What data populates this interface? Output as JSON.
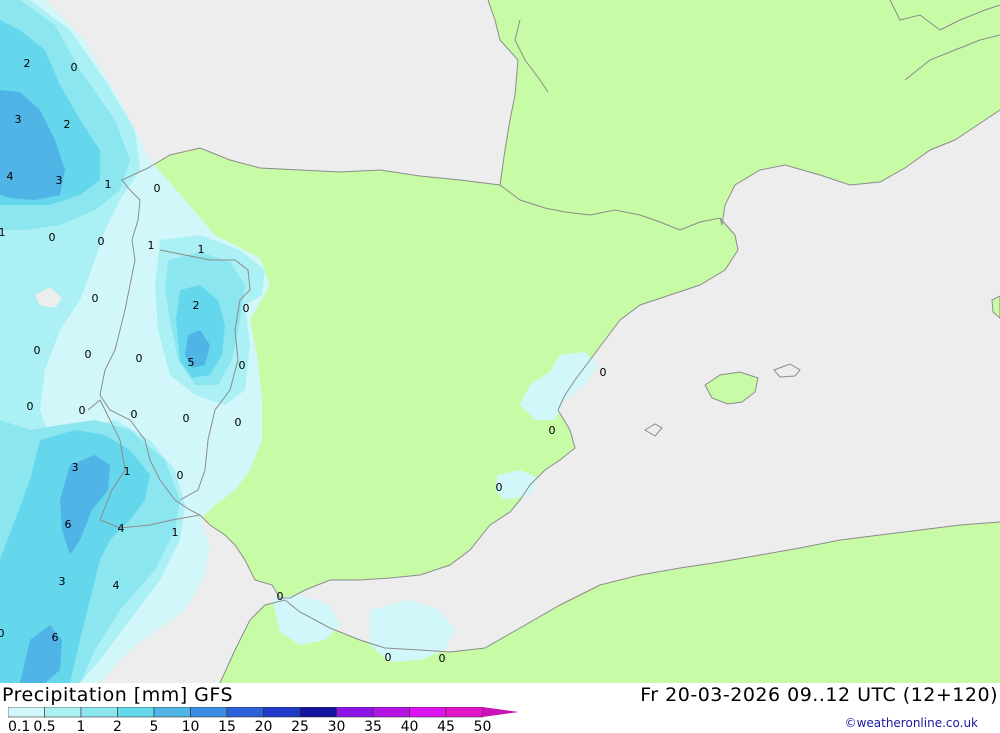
{
  "title": {
    "left": "Precipitation [mm] GFS",
    "right": "Fr 20-03-2026 09..12 UTC (12+120)"
  },
  "credit": "©weatheronline.co.uk",
  "legend": {
    "labels": [
      "0.1",
      "0.5",
      "1",
      "2",
      "5",
      "10",
      "15",
      "20",
      "25",
      "30",
      "35",
      "40",
      "45",
      "50"
    ],
    "colors": [
      "#d2f7fa",
      "#aaf0f5",
      "#8ce6f0",
      "#64d7ec",
      "#50b4e6",
      "#3c8ce1",
      "#2a60d8",
      "#1e3cc8",
      "#1414a0",
      "#8c14e6",
      "#b414e6",
      "#dc14f0",
      "#e614c8",
      "#c814b4"
    ]
  },
  "colors": {
    "sea": "#ededed",
    "land": "#c8fba6",
    "border": "#8c8c8c"
  },
  "map_labels": [
    {
      "text": "2"
    },
    {
      "text": "0"
    },
    {
      "text": "3"
    },
    {
      "text": "2"
    },
    {
      "text": "4"
    },
    {
      "text": "3"
    },
    {
      "text": "1"
    },
    {
      "text": "0"
    },
    {
      "text": "1"
    },
    {
      "text": "0"
    },
    {
      "text": "0"
    },
    {
      "text": "1"
    },
    {
      "text": "1"
    },
    {
      "text": "0"
    },
    {
      "text": "2"
    },
    {
      "text": "0"
    },
    {
      "text": "0"
    },
    {
      "text": "0"
    },
    {
      "text": "0"
    },
    {
      "text": "5"
    },
    {
      "text": "0"
    },
    {
      "text": "0"
    },
    {
      "text": "0"
    },
    {
      "text": "0"
    },
    {
      "text": "0"
    },
    {
      "text": "0"
    },
    {
      "text": "3"
    },
    {
      "text": "1"
    },
    {
      "text": "0"
    },
    {
      "text": "6"
    },
    {
      "text": "4"
    },
    {
      "text": "1"
    },
    {
      "text": "3"
    },
    {
      "text": "4"
    },
    {
      "text": "0"
    },
    {
      "text": "6"
    },
    {
      "text": "0"
    },
    {
      "text": "0"
    },
    {
      "text": "0"
    },
    {
      "text": "0"
    },
    {
      "text": "0"
    }
  ]
}
